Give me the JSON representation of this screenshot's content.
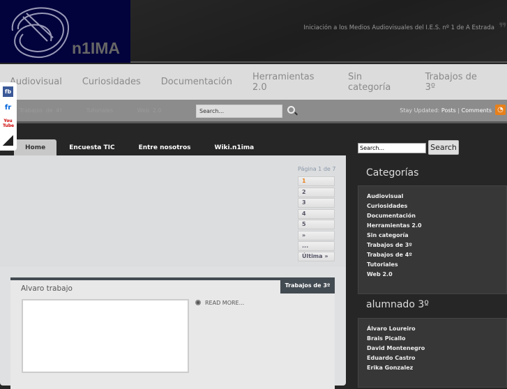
{
  "header": {
    "logo_text": "n1IMA",
    "tagline": "Iniciación a los Medios Audiovisuales del I.E.S. nº 1 de A Estrada"
  },
  "category_nav": [
    "Audiovisual",
    "Curiosidades",
    "Documentación",
    "Herramientas 2.0",
    "Sin categoría",
    "Trabajos de 3º"
  ],
  "category_nav_overflow": [
    "Trabajos de 4º",
    "Tutoriales",
    "Web 2.0"
  ],
  "topbar": {
    "search_placeholder": "Search...",
    "stay_updated": "Stay Updated:",
    "posts": "Posts",
    "separator": "|",
    "comments": "Comments"
  },
  "social": [
    "fb",
    "fr",
    "You Tube",
    "delicious"
  ],
  "tabs": [
    "Home",
    "Encuesta TIC",
    "Entre nosotros",
    "Wiki.n1ima"
  ],
  "sidebar_search": {
    "placeholder": "Search...",
    "button": "Search"
  },
  "pagination": {
    "info": "Página 1 de 7",
    "pages": [
      "1",
      "2",
      "3",
      "4",
      "5",
      "»",
      "...",
      "Última »"
    ],
    "current": "1"
  },
  "post": {
    "title": "Alvaro trabajo",
    "category": "Trabajos de 3º",
    "read_more": "READ MORE..."
  },
  "sidebar": {
    "categories_title": "Categorías",
    "categories": [
      "Audiovisual",
      "Curiosidades",
      "Documentación",
      "Herramientas 2.0",
      "Sin categoría",
      "Trabajos de 3º",
      "Trabajos de 4º",
      "Tutoriales",
      "Web 2.0"
    ],
    "students_title": "alumnado 3º",
    "students": [
      "Álvaro Loureiro",
      "Brais Picallo",
      "David Montenegro",
      "Eduardo Castro",
      "Erika Gonzalez"
    ]
  }
}
